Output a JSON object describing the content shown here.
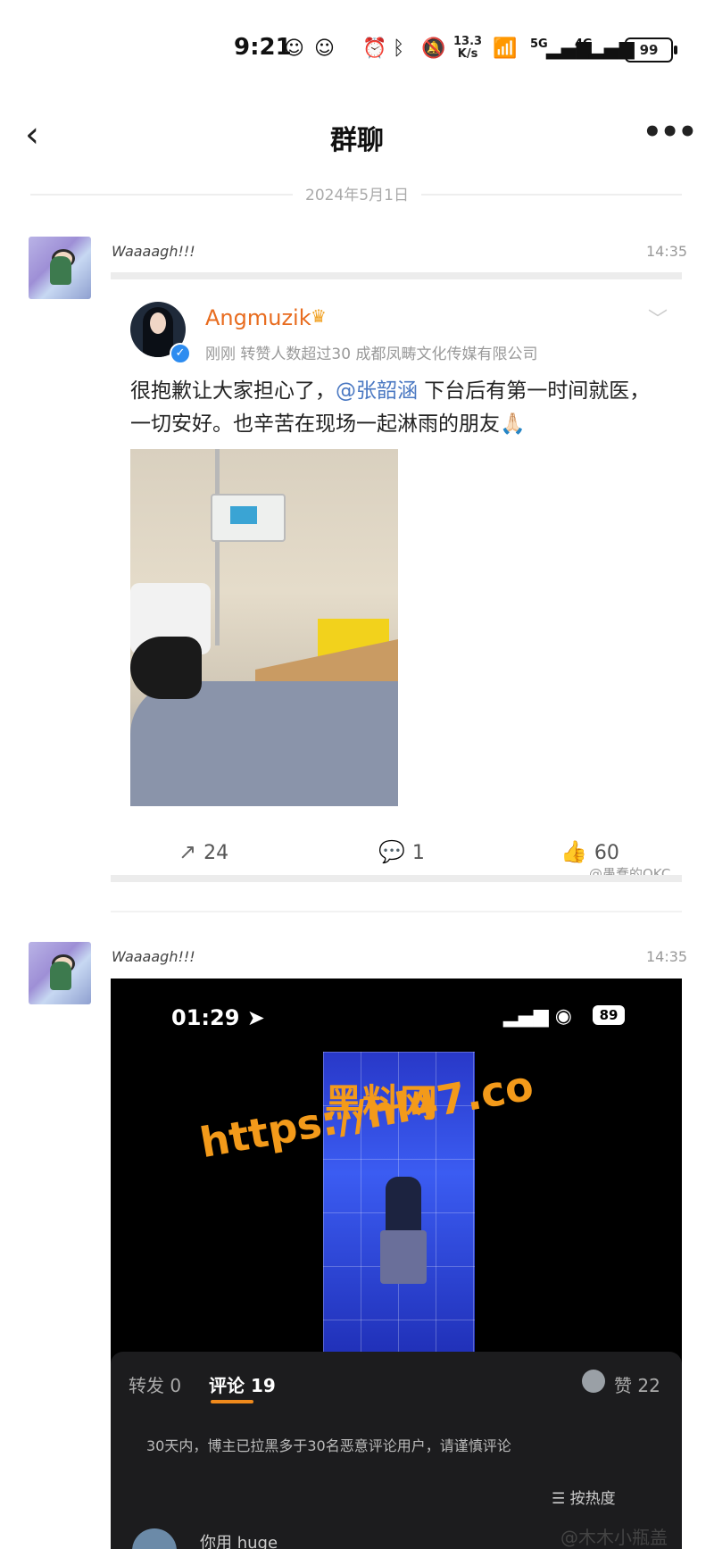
{
  "status": {
    "time": "9:21",
    "speed_top": "13.3",
    "speed_bottom": "K/s",
    "battery": "99",
    "net1": "5G",
    "net2": "4G",
    "wifi_sup": "6"
  },
  "nav": {
    "title": "群聊"
  },
  "date_divider": "2024年5月1日",
  "messages": [
    {
      "sender": "Waaaagh!!!",
      "time": "14:35"
    },
    {
      "sender": "Waaaagh!!!",
      "time": "14:35"
    }
  ],
  "weibo": {
    "author": "Angmuzik",
    "meta": "刚刚 转赞人数超过30 成都凤畴文化传媒有限公司",
    "text_before": "很抱歉让大家担心了，",
    "mention": "@张韶涵",
    "text_after": " 下台后有第一时间就医，一切安好。也辛苦在现场一起淋雨的朋友🙏🏻",
    "reposts": "24",
    "comments": "1",
    "likes": "60",
    "watermark": "@愚蠢的OKC"
  },
  "video": {
    "time": "01:29",
    "battery": "89",
    "overlay1": "黑料网",
    "overlay2": "https://hl47.co",
    "tab_repost": "转发 0",
    "tab_comment": "评论 19",
    "tab_like": "赞 22",
    "notice": "30天内，博主已拉黑多于30名恶意评论用户，请谨慎评论",
    "sort": "按热度",
    "commenter": "你用 huge"
  },
  "watermark2": "@木木小瓶盖",
  "icons": [
    "back-arrow-icon",
    "more-icon",
    "alarm-icon",
    "bluetooth-icon",
    "mute-icon",
    "wifi-icon",
    "signal-icon",
    "repost-icon",
    "comment-icon",
    "like-icon",
    "verified-icon",
    "crown-icon",
    "chevron-down-icon",
    "location-arrow-icon"
  ]
}
